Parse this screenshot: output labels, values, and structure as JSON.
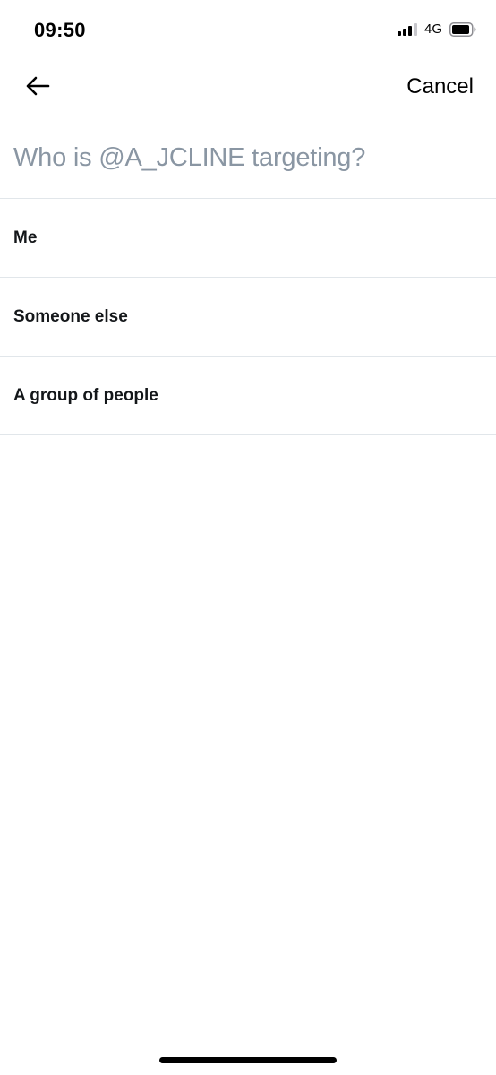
{
  "status_bar": {
    "time": "09:50",
    "network": "4G",
    "icons": [
      "signal-icon",
      "battery-icon"
    ]
  },
  "nav": {
    "back_icon": "arrow-left-icon",
    "cancel_label": "Cancel"
  },
  "prompt": {
    "text": "Who is @A_JCLINE targeting?"
  },
  "options": [
    {
      "label": "Me"
    },
    {
      "label": "Someone else"
    },
    {
      "label": "A group of people"
    }
  ],
  "colors": {
    "prompt_text": "#8a96a3",
    "option_text": "#14171a",
    "divider": "#e1e6ea"
  }
}
